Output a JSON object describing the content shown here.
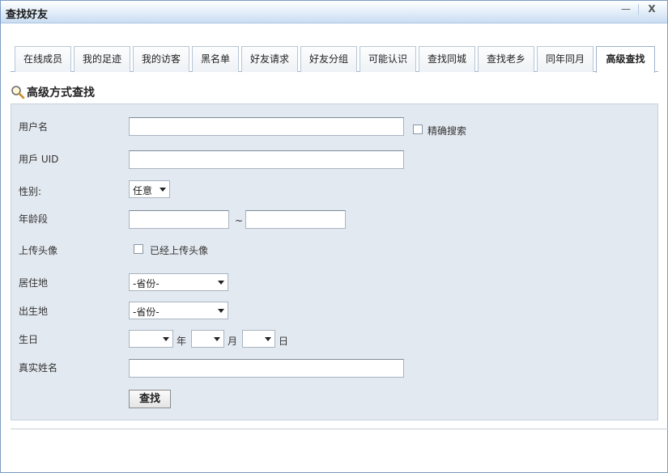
{
  "window": {
    "title": "查找好友",
    "min_label": "—",
    "close_label": "X"
  },
  "tabs": [
    {
      "label": "在线成员"
    },
    {
      "label": "我的足迹"
    },
    {
      "label": "我的访客"
    },
    {
      "label": "黑名单"
    },
    {
      "label": "好友请求"
    },
    {
      "label": "好友分组"
    },
    {
      "label": "可能认识"
    },
    {
      "label": "查找同城"
    },
    {
      "label": "查找老乡"
    },
    {
      "label": "同年同月"
    },
    {
      "label": "高级查找",
      "active": true
    }
  ],
  "section": {
    "title": "高级方式查找",
    "icon": "magnifier-icon"
  },
  "form": {
    "username_label": "用户名",
    "username_value": "",
    "exact_search_label": "精确搜索",
    "uid_label": "用戶 UID",
    "uid_value": "",
    "gender_label": "性别:",
    "gender_value": "任意",
    "age_label": "年龄段",
    "age_from": "",
    "age_to": "",
    "age_sep": "~",
    "avatar_label": "上传头像",
    "avatar_checkbox_label": "已经上传头像",
    "residence_label": "居住地",
    "residence_value": "-省份-",
    "birthplace_label": "出生地",
    "birthplace_value": "-省份-",
    "birthday_label": "生日",
    "birthday_year_value": "",
    "birthday_year_unit": "年",
    "birthday_month_value": "",
    "birthday_month_unit": "月",
    "birthday_day_value": "",
    "birthday_day_unit": "日",
    "realname_label": "真实姓名",
    "realname_value": "",
    "search_button": "查找"
  }
}
